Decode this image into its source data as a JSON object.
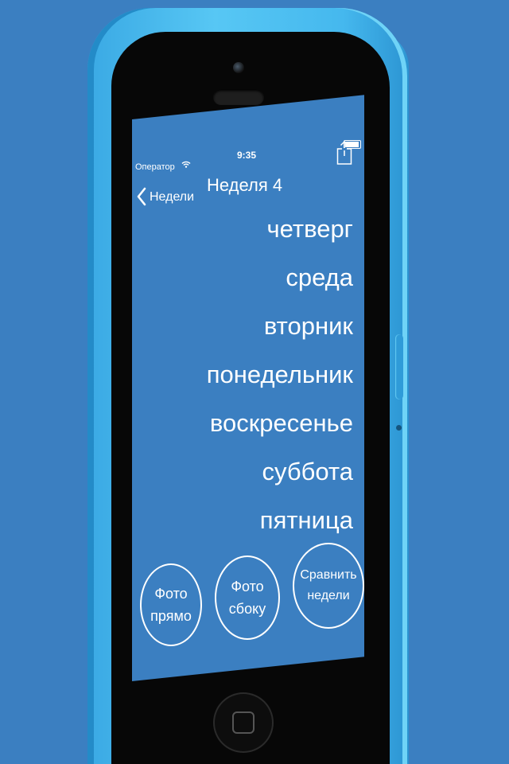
{
  "status_bar": {
    "carrier": "Оператор",
    "wifi_icon": "wifi-icon",
    "time": "9:35",
    "battery_icon": "battery-icon"
  },
  "nav": {
    "back_label": "Недели",
    "back_icon": "chevron-left-icon",
    "title": "Неделя 4",
    "share_icon": "share-icon"
  },
  "days": [
    "четверг",
    "среда",
    "вторник",
    "понедельник",
    "воскресенье",
    "суббота",
    "пятница"
  ],
  "buttons": {
    "photo_front": "Фото\nпрямо",
    "photo_side": "Фото\nсбоку",
    "compare_weeks": "Сравнить\nнедели"
  },
  "colors": {
    "background": "#3b7fc1",
    "phone_body": "#45b8ee",
    "text": "#ffffff"
  }
}
